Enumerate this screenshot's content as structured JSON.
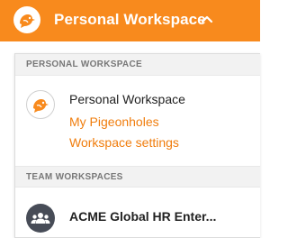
{
  "header": {
    "workspace_title": "Personal Workspace",
    "accent_color": "#f88a1d"
  },
  "dropdown": {
    "personal_section_label": "PERSONAL WORKSPACE",
    "personal_name": "Personal Workspace",
    "links": [
      {
        "label": "My Pigeonholes"
      },
      {
        "label": "Workspace settings"
      }
    ],
    "team_section_label": "TEAM WORKSPACES",
    "team_items": [
      {
        "label": "ACME Global HR Enter..."
      }
    ],
    "link_color": "#f07d0d"
  },
  "icons": {
    "logo": "pigeon-logo-icon",
    "caret": "chevron-up-icon",
    "personal_avatar": "pigeon-avatar-icon",
    "team_avatar": "group-icon"
  }
}
